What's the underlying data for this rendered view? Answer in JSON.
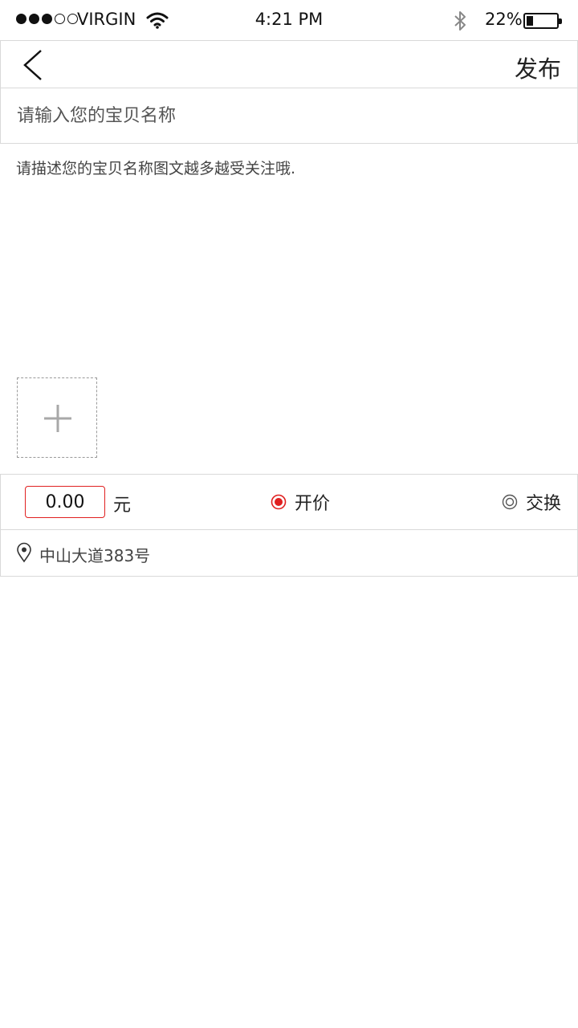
{
  "status_bar": {
    "carrier": "VIRGIN",
    "time": "4:21 PM",
    "battery_percent": "22%",
    "signal_strength": 3,
    "signal_max": 5,
    "battery_level": 0.22
  },
  "nav": {
    "back_icon": "chevron-left-icon",
    "publish_label": "发布"
  },
  "form": {
    "title_placeholder": "请输入您的宝贝名称",
    "description_placeholder": "请描述您的宝贝名称图文越多越受关注哦.",
    "add_photo_icon": "plus-icon",
    "price_value": "0.00",
    "currency_label": "元",
    "options": [
      {
        "label": "开价",
        "selected": true
      },
      {
        "label": "交换",
        "selected": false
      }
    ],
    "location_icon": "map-pin-icon",
    "location": "中山大道383号"
  },
  "colors": {
    "accent": "#e02020",
    "border": "#d9d9d9",
    "text": "#333333"
  }
}
